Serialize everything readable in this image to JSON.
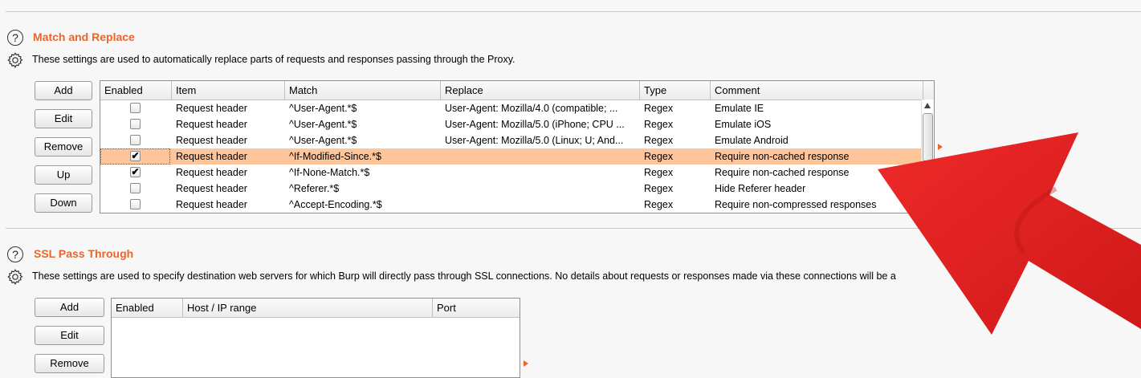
{
  "match_replace": {
    "title": "Match and Replace",
    "description": "These settings are used to automatically replace parts of requests and responses passing through the Proxy.",
    "buttons": [
      "Add",
      "Edit",
      "Remove",
      "Up",
      "Down"
    ],
    "columns": [
      "Enabled",
      "Item",
      "Match",
      "Replace",
      "Type",
      "Comment"
    ],
    "rows": [
      {
        "enabled": false,
        "item": "Request header",
        "match": "^User-Agent.*$",
        "replace": "User-Agent: Mozilla/4.0 (compatible; ...",
        "type": "Regex",
        "comment": "Emulate IE"
      },
      {
        "enabled": false,
        "item": "Request header",
        "match": "^User-Agent.*$",
        "replace": "User-Agent: Mozilla/5.0 (iPhone; CPU ...",
        "type": "Regex",
        "comment": "Emulate iOS"
      },
      {
        "enabled": false,
        "item": "Request header",
        "match": "^User-Agent.*$",
        "replace": "User-Agent: Mozilla/5.0 (Linux; U; And...",
        "type": "Regex",
        "comment": "Emulate Android"
      },
      {
        "enabled": true,
        "item": "Request header",
        "match": "^If-Modified-Since.*$",
        "replace": "",
        "type": "Regex",
        "comment": "Require non-cached response",
        "selected": true
      },
      {
        "enabled": true,
        "item": "Request header",
        "match": "^If-None-Match.*$",
        "replace": "",
        "type": "Regex",
        "comment": "Require non-cached response"
      },
      {
        "enabled": false,
        "item": "Request header",
        "match": "^Referer.*$",
        "replace": "",
        "type": "Regex",
        "comment": "Hide Referer header"
      },
      {
        "enabled": false,
        "item": "Request header",
        "match": "^Accept-Encoding.*$",
        "replace": "",
        "type": "Regex",
        "comment": "Require non-compressed responses"
      }
    ]
  },
  "ssl_pass_through": {
    "title": "SSL Pass Through",
    "description": "These settings are used to specify destination web servers for which Burp will directly pass through SSL connections. No details about requests or responses made via these connections will be a",
    "buttons": [
      "Add",
      "Edit",
      "Remove"
    ],
    "columns": [
      "Enabled",
      "Host / IP range",
      "Port"
    ]
  },
  "icons": {
    "help": "help-circle-icon",
    "settings": "gear-icon",
    "annotation": "red-arrow-icon"
  },
  "colors": {
    "accent": "#e8662c",
    "selected_row": "#ffc59a",
    "arrow": "#e01e1e"
  }
}
